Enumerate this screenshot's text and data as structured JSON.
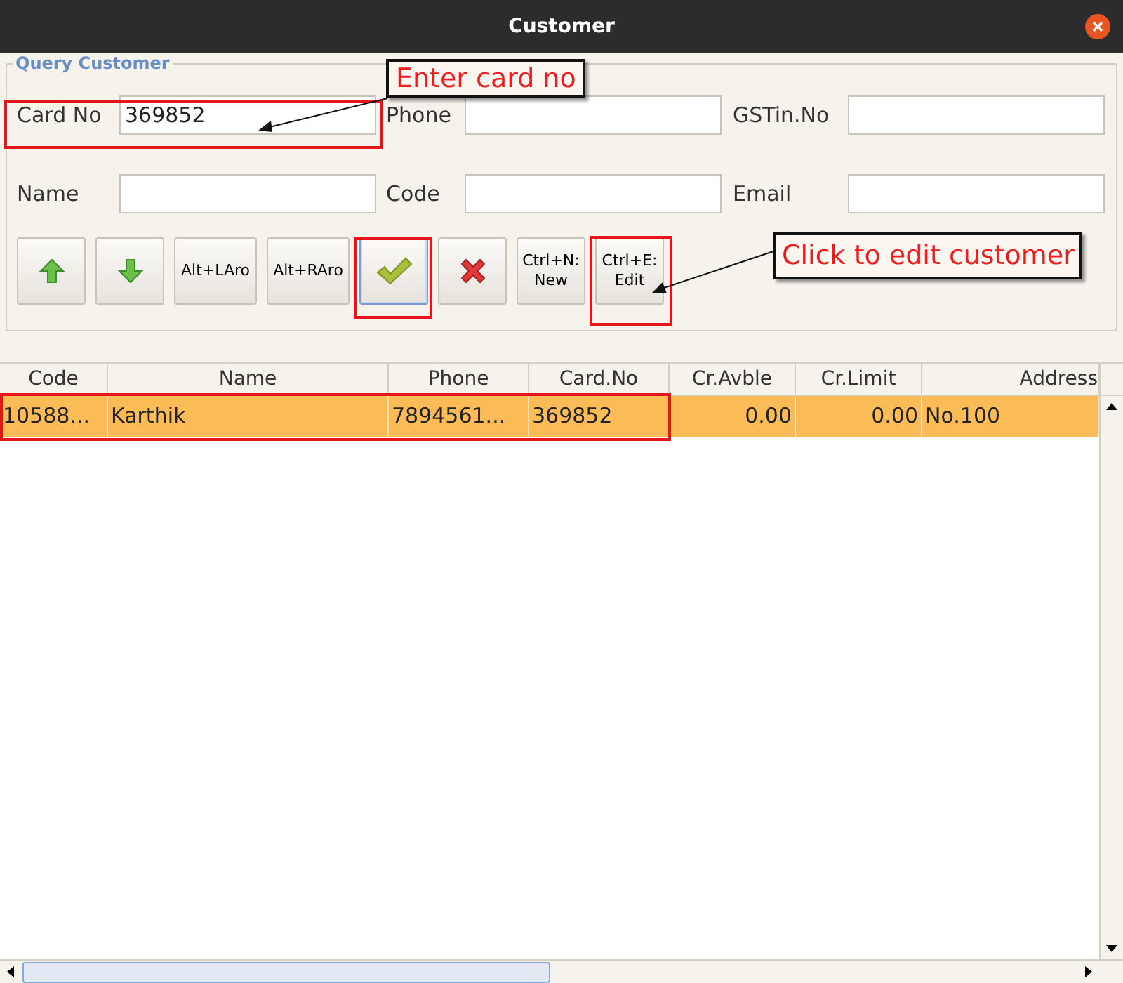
{
  "window": {
    "title": "Customer"
  },
  "query": {
    "legend": "Query Customer",
    "rows": [
      [
        {
          "label": "Card No",
          "value": "369852"
        },
        {
          "label": "Phone"
        },
        {
          "label": "GSTin.No"
        }
      ],
      [
        {
          "label": "Name"
        },
        {
          "label": "Code"
        },
        {
          "label": "Email"
        }
      ]
    ]
  },
  "buttons": [
    {
      "kind": "up",
      "focused": false
    },
    {
      "kind": "down",
      "focused": false
    },
    {
      "kind": "text",
      "lines": [
        "Alt+LAro"
      ],
      "focused": false
    },
    {
      "kind": "text",
      "lines": [
        "Alt+RAro"
      ],
      "focused": false
    },
    {
      "kind": "ok",
      "focused": true
    },
    {
      "kind": "cancel",
      "focused": false
    },
    {
      "kind": "text",
      "lines": [
        "Ctrl+N:",
        "New"
      ],
      "focused": false
    },
    {
      "kind": "text",
      "lines": [
        "Ctrl+E:",
        "Edit"
      ],
      "focused": false
    }
  ],
  "table": {
    "columns": [
      {
        "label": "Code",
        "kind": "text"
      },
      {
        "label": "Name",
        "kind": "text"
      },
      {
        "label": "Phone",
        "kind": "text"
      },
      {
        "label": "Card.No",
        "kind": "text"
      },
      {
        "label": "Cr.Avble",
        "kind": "number"
      },
      {
        "label": "Cr.Limit",
        "kind": "number"
      },
      {
        "label": "Address",
        "kind": "text"
      }
    ],
    "rows": [
      {
        "selected": true,
        "cells": [
          "10588...",
          "Karthik",
          "7894561...",
          "369852",
          "0.00",
          "0.00",
          "No.100"
        ]
      }
    ]
  },
  "annotations": [
    {
      "text": "Enter card no"
    },
    {
      "text": "Click to edit customer"
    }
  ]
}
